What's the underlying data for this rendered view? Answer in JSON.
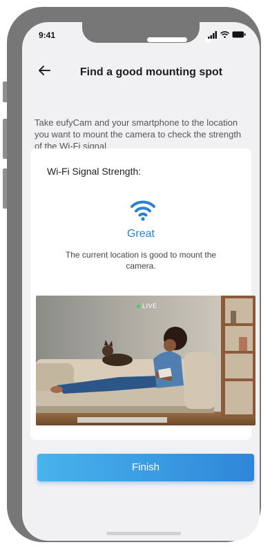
{
  "status_bar": {
    "time": "9:41"
  },
  "nav": {
    "title": "Find a good mounting spot"
  },
  "intro": {
    "text": "Take eufyCam and your smartphone to the location you want to mount the camera to check the strength of the Wi-Fi signal."
  },
  "signal": {
    "label": "Wi-Fi Signal Strength:",
    "value": "Great",
    "description": "The current location is good to mount the camera."
  },
  "camera": {
    "live_label": "LIVE"
  },
  "actions": {
    "finish_label": "Finish"
  },
  "colors": {
    "accent": "#2a7fd0",
    "button_start": "#48b3ec",
    "button_end": "#2f86d9",
    "live": "#37d26a"
  }
}
